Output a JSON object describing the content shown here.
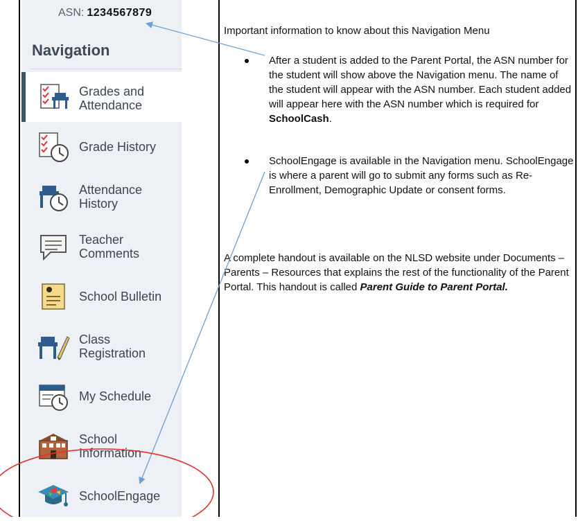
{
  "asn": {
    "label": "ASN:",
    "number": "1234567879"
  },
  "navigation": {
    "title": "Navigation",
    "items": [
      {
        "label": "Grades and\nAttendance",
        "icon": "grades-attendance-icon",
        "active": true
      },
      {
        "label": "Grade History",
        "icon": "grade-history-icon"
      },
      {
        "label": "Attendance\nHistory",
        "icon": "attendance-history-icon"
      },
      {
        "label": "Teacher\nComments",
        "icon": "teacher-comments-icon"
      },
      {
        "label": "School Bulletin",
        "icon": "school-bulletin-icon"
      },
      {
        "label": "Class\nRegistration",
        "icon": "class-registration-icon"
      },
      {
        "label": "My Schedule",
        "icon": "my-schedule-icon"
      },
      {
        "label": "School\nInformation",
        "icon": "school-information-icon"
      },
      {
        "label": "SchoolEngage",
        "icon": "school-engage-icon"
      }
    ]
  },
  "content": {
    "intro": "Important information to know about this Navigation Menu",
    "bullet1": {
      "text": "After a student is added to the Parent Portal, the ASN number for the student will show above the Navigation menu.   The name of the student will appear with the ASN number.   Each student added will appear here with the ASN number which is required for ",
      "bold": "SchoolCash",
      "end": "."
    },
    "bullet2": "SchoolEngage is available in the Navigation menu. SchoolEngage is where a parent will go to submit any forms such as Re-Enrollment, Demographic Update or consent forms.",
    "handout": {
      "text": "A complete handout is available on the NLSD website under Documents – Parents – Resources that explains the rest of the functionality of the Parent Portal.  This handout is called ",
      "bold_italic": "Parent Guide to Parent Portal."
    }
  },
  "colors": {
    "arrow": "#6a9fd4",
    "circle": "#e03030",
    "active_bar": "#3a5568"
  }
}
